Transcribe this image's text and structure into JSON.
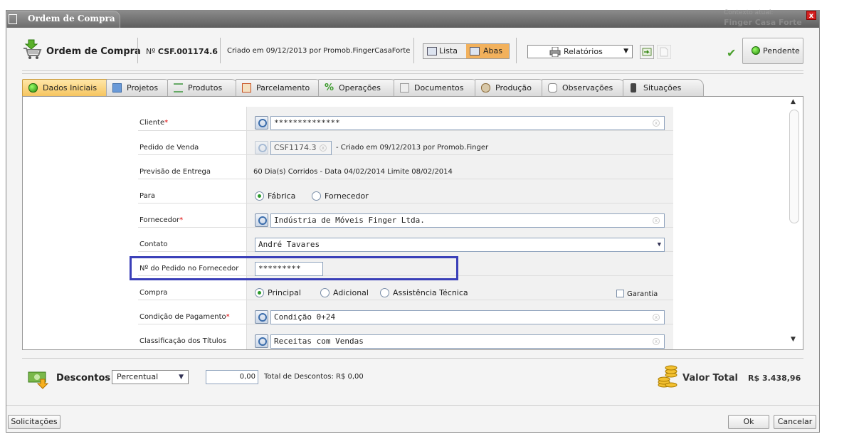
{
  "window": {
    "title": "Ordem de Compra",
    "context_label": "Contexto atual:",
    "context_value": "Finger Casa Forte",
    "close_label": "x"
  },
  "header": {
    "title": "Ordem de Compra",
    "number_prefix": "Nº",
    "number": "CSF.001174.6",
    "created": "Criado em 09/12/2013 por Promob.FingerCasaForte",
    "view_list": "Lista",
    "view_tabs": "Abas",
    "reports": "Relatórios",
    "status": "Pendente"
  },
  "tabs": [
    {
      "label": "Dados Iniciais",
      "active": true
    },
    {
      "label": "Projetos"
    },
    {
      "label": "Produtos"
    },
    {
      "label": "Parcelamento"
    },
    {
      "label": "Operações"
    },
    {
      "label": "Documentos"
    },
    {
      "label": "Produção"
    },
    {
      "label": "Observações"
    },
    {
      "label": "Situações"
    }
  ],
  "form": {
    "cliente_label": "Cliente",
    "cliente_value": "**************",
    "pedido_label": "Pedido de Venda",
    "pedido_code": "CSF1174.3",
    "pedido_info": "- Criado em  09/12/2013  por  Promob.Finger",
    "previsao_label": "Previsão de Entrega",
    "previsao_value": "60 Dia(s) Corridos - Data 04/02/2014 Limite 08/02/2014",
    "para_label": "Para",
    "para_opt1": "Fábrica",
    "para_opt2": "Fornecedor",
    "fornecedor_label": "Fornecedor",
    "fornecedor_value": "Indústria de Móveis Finger Ltda.",
    "contato_label": "Contato",
    "contato_value": "André Tavares",
    "npedido_label": "Nº do Pedido no Fornecedor",
    "npedido_value": "*********",
    "compra_label": "Compra",
    "compra_opt1": "Principal",
    "compra_opt2": "Adicional",
    "compra_opt3": "Assistência Técnica",
    "garantia_label": "Garantia",
    "condicao_label": "Condição de Pagamento",
    "condicao_value": "Condição 0+24",
    "classif_label": "Classificação dos Títulos",
    "classif_value": "Receitas com Vendas",
    "required_mark": "*"
  },
  "footer": {
    "descontos_label": "Descontos",
    "tipo": "Percentual",
    "valor": "0,00",
    "total_desc": "Total de Descontos:  R$ 0,00",
    "valor_total_label": "Valor Total",
    "valor_total": "R$ 3.438,96"
  },
  "buttons": {
    "solicitacoes": "Solicitações",
    "ok": "Ok",
    "cancelar": "Cancelar"
  }
}
